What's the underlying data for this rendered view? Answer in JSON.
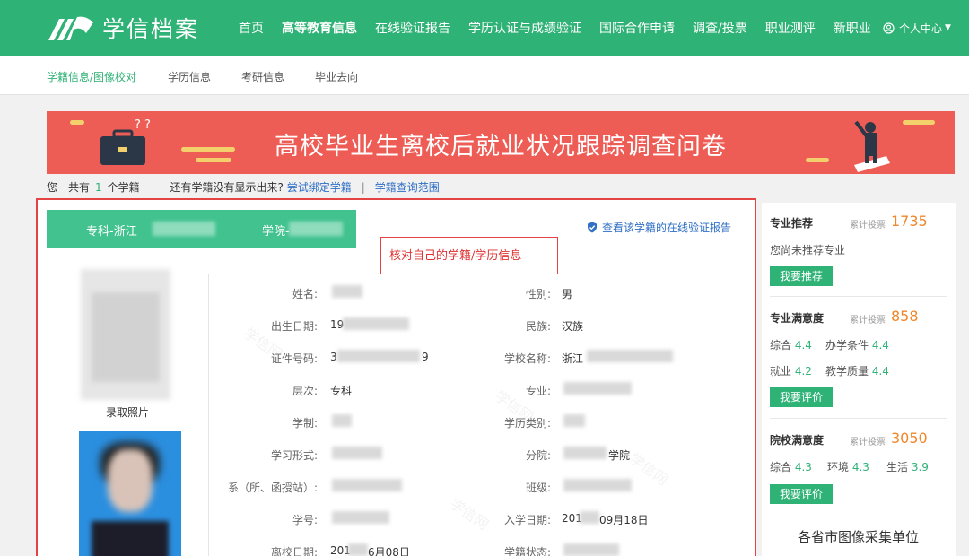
{
  "header": {
    "logo_text": "学信档案",
    "nav": [
      "首页",
      "高等教育信息",
      "在线验证报告",
      "学历认证与成绩验证",
      "国际合作申请",
      "调查/投票",
      "职业测评",
      "新职业"
    ],
    "user_menu": "个人中心"
  },
  "subnav": [
    "学籍信息/图像校对",
    "学历信息",
    "考研信息",
    "毕业去向"
  ],
  "banner": {
    "title": "高校毕业生离校后就业状况跟踪调查问卷"
  },
  "summary": {
    "prefix": "您一共有",
    "count": "1",
    "suffix": "个学籍",
    "question": "还有学籍没有显示出来?",
    "link_bind": "尝试绑定学籍",
    "sep": "|",
    "link_scope": "学籍查询范围"
  },
  "record": {
    "school_tab_prefix": "专科-浙江",
    "school_tab_mid": "学院-",
    "verify_link": "查看该学籍的在线验证报告",
    "annotation": "核对自己的学籍/学历信息",
    "photo_label": "录取照片",
    "watermark": "学信网",
    "fields_left": [
      {
        "label": "姓名:",
        "value": ""
      },
      {
        "label": "出生日期:",
        "value": "19"
      },
      {
        "label": "证件号码:",
        "value": "3",
        "tail": "9"
      },
      {
        "label": "层次:",
        "value": "专科"
      },
      {
        "label": "学制:",
        "value": ""
      },
      {
        "label": "学习形式:",
        "value": ""
      },
      {
        "label": "系（所、函授站）:",
        "value": ""
      },
      {
        "label": "学号:",
        "value": ""
      },
      {
        "label": "离校日期:",
        "value": "201",
        "tail": "6月08日"
      }
    ],
    "fields_right": [
      {
        "label": "性别:",
        "value": "男"
      },
      {
        "label": "民族:",
        "value": "汉族"
      },
      {
        "label": "学校名称:",
        "value": "浙江"
      },
      {
        "label": "专业:",
        "value": ""
      },
      {
        "label": "学历类别:",
        "value": ""
      },
      {
        "label": "分院:",
        "value": "学院"
      },
      {
        "label": "班级:",
        "value": ""
      },
      {
        "label": "入学日期:",
        "value": "201",
        "tail": "09月18日"
      },
      {
        "label": "学籍状态:",
        "value": ""
      }
    ]
  },
  "side": {
    "major_rec": {
      "title": "专业推荐",
      "votes_label": "累计投票",
      "votes": "1735",
      "text": "您尚未推荐专业",
      "button": "我要推荐"
    },
    "major_sat": {
      "title": "专业满意度",
      "votes_label": "累计投票",
      "votes": "858",
      "r1": [
        {
          "k": "综合",
          "v": "4.4"
        },
        {
          "k": "办学条件",
          "v": "4.4"
        }
      ],
      "r2": [
        {
          "k": "就业",
          "v": "4.2"
        },
        {
          "k": "教学质量",
          "v": "4.4"
        }
      ],
      "button": "我要评价"
    },
    "school_sat": {
      "title": "院校满意度",
      "votes_label": "累计投票",
      "votes": "3050",
      "r1": [
        {
          "k": "综合",
          "v": "4.3"
        },
        {
          "k": "环境",
          "v": "4.3"
        },
        {
          "k": "生活",
          "v": "3.9"
        }
      ],
      "button": "我要评价"
    },
    "footer": "各省市图像采集单位"
  },
  "colors": {
    "brand": "#2fb276",
    "banner": "#ee5d55",
    "link": "#2f6fc5",
    "alert": "#e34343",
    "count": "#f0872b"
  }
}
